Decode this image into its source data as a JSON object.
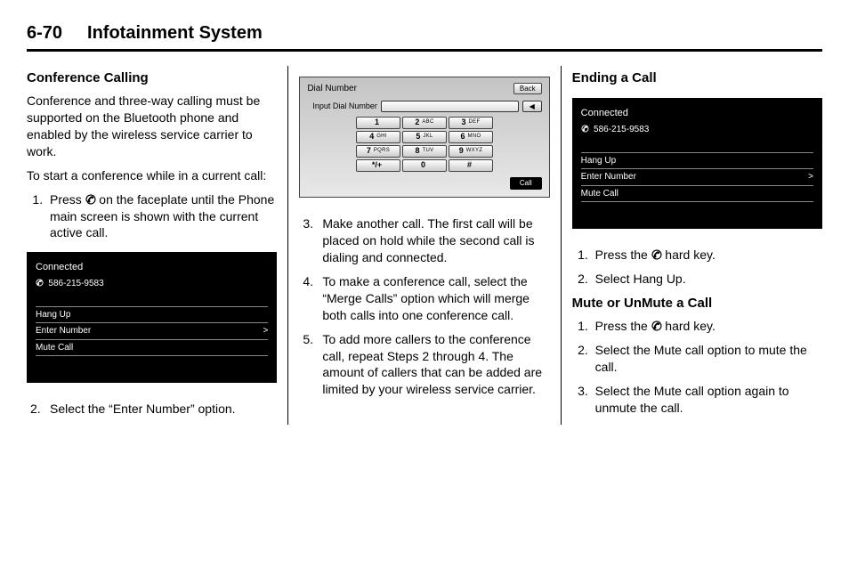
{
  "header": {
    "page_number": "6-70",
    "doc_title": "Infotainment System"
  },
  "col1": {
    "h_conference": "Conference Calling",
    "p1": "Conference and three-way calling must be supported on the Bluetooth phone and enabled by the wireless service carrier to work.",
    "p2": "To start a conference while in a current call:",
    "step1_a": "Press ",
    "step1_b": " on the faceplate until the Phone main screen is shown with the current active call.",
    "fig_connected": {
      "title": "Connected",
      "phone_number": "586-215-9583",
      "menu": [
        "Hang Up",
        "Enter Number",
        "Mute Call"
      ],
      "chevron": ">"
    },
    "step2": "Select the “Enter Number” option."
  },
  "col2": {
    "fig_dial": {
      "title": "Dial Number",
      "back_label": "Back",
      "input_label": "Input Dial Number",
      "arrow": "◀",
      "keys": [
        {
          "d": "1",
          "l": ""
        },
        {
          "d": "2",
          "l": "ABC"
        },
        {
          "d": "3",
          "l": "DEF"
        },
        {
          "d": "4",
          "l": "GHI"
        },
        {
          "d": "5",
          "l": "JKL"
        },
        {
          "d": "6",
          "l": "MNO"
        },
        {
          "d": "7",
          "l": "PQRS"
        },
        {
          "d": "8",
          "l": "TUV"
        },
        {
          "d": "9",
          "l": "WXYZ"
        },
        {
          "d": "*/+",
          "l": ""
        },
        {
          "d": "0",
          "l": ""
        },
        {
          "d": "#",
          "l": ""
        }
      ],
      "call_label": "Call"
    },
    "step3": "Make another call. The first call will be placed on hold while the second call is dialing and connected.",
    "step4": "To make a conference call, select the “Merge Calls” option which will merge both calls into one conference call.",
    "step5": "To add more callers to the conference call, repeat Steps 2 through 4. The amount of callers that can be added are limited by your wireless service carrier."
  },
  "col3": {
    "h_ending": "Ending a Call",
    "fig_connected": {
      "title": "Connected",
      "phone_number": "586-215-9583",
      "menu": [
        "Hang Up",
        "Enter Number",
        "Mute Call"
      ],
      "chevron": ">"
    },
    "end_step1_a": "Press the ",
    "end_step1_b": " hard key.",
    "end_step2": "Select Hang Up.",
    "h_mute": "Mute or UnMute a Call",
    "mute_step1_a": "Press the ",
    "mute_step1_b": " hard key.",
    "mute_step2": "Select the Mute call option to mute the call.",
    "mute_step3": "Select the Mute call option again to unmute the call."
  },
  "icons": {
    "phone": "✆"
  },
  "numbers": {
    "n2": "2.",
    "n3": "3.",
    "n4": "4.",
    "n5": "5."
  }
}
